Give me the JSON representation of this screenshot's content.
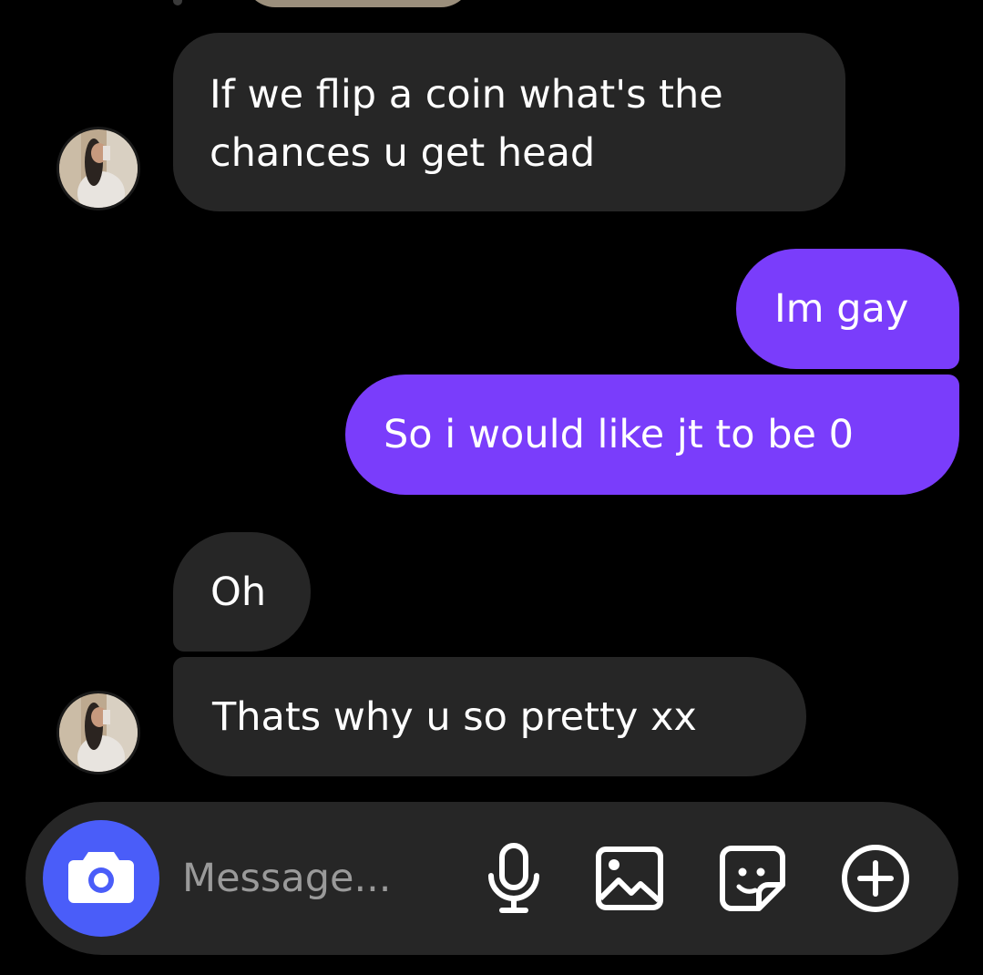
{
  "thread": {
    "messages": [
      {
        "sender": "them",
        "lines": [
          "If we flip a coin what's the",
          "chances u get head"
        ]
      },
      {
        "sender": "me",
        "text": "Im gay"
      },
      {
        "sender": "me",
        "text": "So i would like jt to be 0"
      },
      {
        "sender": "them",
        "text": "Oh"
      },
      {
        "sender": "them",
        "text": "Thats why u so pretty xx"
      }
    ]
  },
  "composer": {
    "placeholder": "Message...",
    "icons": [
      "camera-icon",
      "microphone-icon",
      "gallery-icon",
      "sticker-icon",
      "plus-icon"
    ]
  },
  "colors": {
    "background": "#000000",
    "incoming_bubble": "#262626",
    "outgoing_bubble": "#7a3dfb",
    "camera_button": "#4a5df9",
    "composer": "#262626",
    "placeholder": "#9a9a9a"
  }
}
